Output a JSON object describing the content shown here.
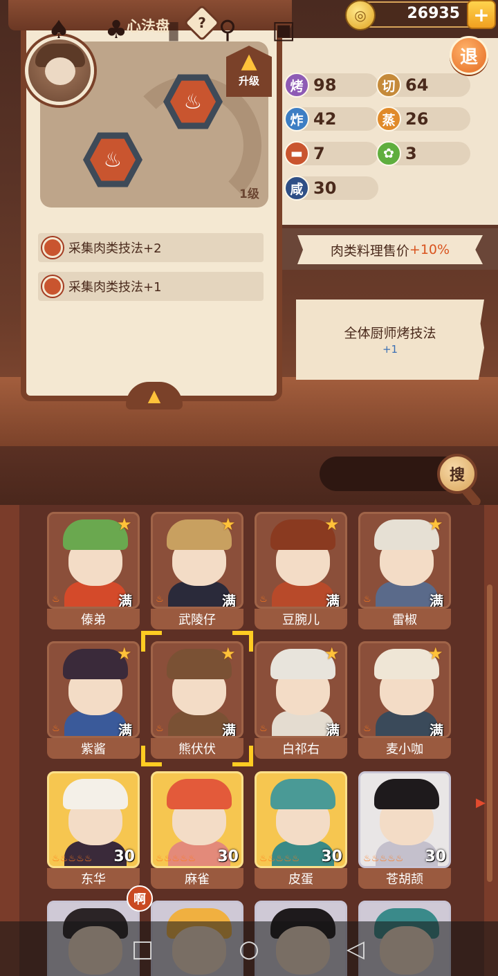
{
  "currency": {
    "value": "26935",
    "plus_label": "+"
  },
  "exit_label": "退",
  "panel": {
    "title": "心法盘",
    "help_label": "?",
    "upgrade_label": "升级",
    "level_label": "1级",
    "skills": [
      {
        "label": "采集肉类技法+2"
      },
      {
        "label": "采集肉类技法+1"
      }
    ]
  },
  "stats": [
    {
      "icon": "烤",
      "value": "98",
      "color": "#8e5bb5"
    },
    {
      "icon": "切",
      "value": "64",
      "color": "#c58a3a"
    },
    {
      "icon": "炸",
      "value": "42",
      "color": "#3d7ec4"
    },
    {
      "icon": "蒸",
      "value": "26",
      "color": "#e08a2a"
    },
    {
      "icon": "meat-icon",
      "value": "7",
      "color": "#c9552f"
    },
    {
      "icon": "vegetable-icon",
      "value": "3",
      "color": "#5fae3e"
    },
    {
      "icon": "咸",
      "value": "30",
      "color": "#2f4f86"
    }
  ],
  "bonus_ribbon": {
    "text": "肉类料理售价",
    "bonus": "+10%"
  },
  "note_card": {
    "text": "全体厨师烤技法",
    "plus": "+1"
  },
  "search_label": "搜",
  "chefs": [
    {
      "name": "傣弟",
      "status": "满",
      "tier": "normal"
    },
    {
      "name": "武陵仔",
      "status": "满",
      "tier": "normal"
    },
    {
      "name": "豆腕儿",
      "status": "满",
      "tier": "normal"
    },
    {
      "name": "雷椒",
      "status": "满",
      "tier": "normal"
    },
    {
      "name": "紫酱",
      "status": "满",
      "tier": "normal"
    },
    {
      "name": "熊伏伏",
      "status": "满",
      "tier": "normal"
    },
    {
      "name": "白祁右",
      "status": "满",
      "tier": "normal"
    },
    {
      "name": "麦小咖",
      "status": "满",
      "tier": "normal"
    },
    {
      "name": "东华",
      "level": "30",
      "tier": "gold"
    },
    {
      "name": "麻雀",
      "level": "30",
      "tier": "gold"
    },
    {
      "name": "皮蛋",
      "level": "30",
      "tier": "gold"
    },
    {
      "name": "苍胡颉",
      "level": "30",
      "tier": "silver"
    }
  ],
  "chef_badge": "啊"
}
